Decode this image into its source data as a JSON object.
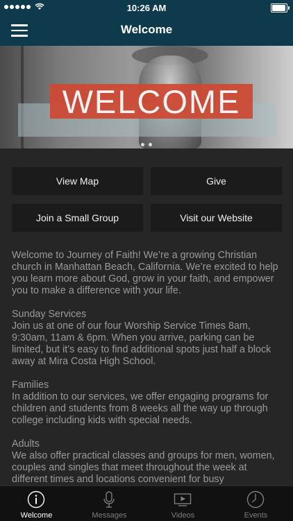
{
  "status_bar": {
    "time": "10:26 AM"
  },
  "nav": {
    "title": "Welcome"
  },
  "hero": {
    "banner_text": "WELCOME"
  },
  "buttons": {
    "view_map": "View Map",
    "give": "Give",
    "small_group": "Join a Small Group",
    "website": "Visit our Website"
  },
  "content": {
    "intro": "Welcome to Journey of Faith! We’re a growing Christian church in Manhattan Beach, California. We’re excited to help you learn more about God, grow in your faith, and empower you to make a difference with your life.",
    "sections": [
      {
        "heading": "Sunday Services",
        "body": "Join us at one of our four Worship Service Times 8am, 9:30am, 11am & 6pm. When you arrive, parking can be limited, but it’s easy to find additional spots just half a block away at Mira Costa High School."
      },
      {
        "heading": "Families",
        "body": "In addition to our services, we offer engaging programs for children and students from 8 weeks all the way up through college including kids with special needs."
      },
      {
        "heading": "Adults",
        "body": "We also offer practical classes and groups for men, women, couples and singles that meet throughout the week at different times and locations convenient for busy"
      }
    ]
  },
  "tabs": [
    {
      "label": "Welcome",
      "icon": "info-icon",
      "active": true
    },
    {
      "label": "Messages",
      "icon": "microphone-icon",
      "active": false
    },
    {
      "label": "Videos",
      "icon": "video-icon",
      "active": false
    },
    {
      "label": "Events",
      "icon": "clock-icon",
      "active": false
    }
  ],
  "colors": {
    "nav_background": "#0e3b4b",
    "page_background": "#262626",
    "button_background": "#1b1b1b",
    "banner_red": "#ce4832"
  }
}
